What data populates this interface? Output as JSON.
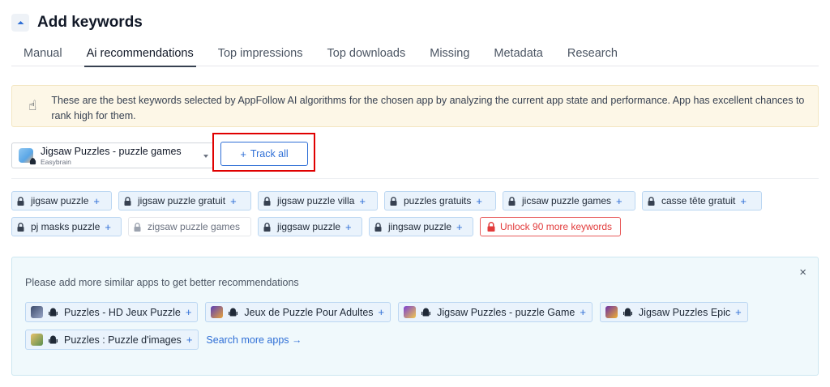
{
  "header": {
    "title": "Add keywords"
  },
  "tabs": [
    {
      "label": "Manual",
      "active": false
    },
    {
      "label": "Ai recommendations",
      "active": true
    },
    {
      "label": "Top impressions",
      "active": false
    },
    {
      "label": "Top downloads",
      "active": false
    },
    {
      "label": "Missing",
      "active": false
    },
    {
      "label": "Metadata",
      "active": false
    },
    {
      "label": "Research",
      "active": false
    }
  ],
  "info": {
    "icon": "pointing-hand-icon",
    "text": "These are the best keywords selected by AppFollow AI algorithms for the chosen app by analyzing the current app state and performance. App has excellent chances to rank high for them."
  },
  "app_select": {
    "name": "Jigsaw Puzzles - puzzle games",
    "developer": "Easybrain"
  },
  "track_all": {
    "label": "Track all"
  },
  "keywords": {
    "row1": [
      {
        "label": "jigsaw puzzle"
      },
      {
        "label": "jigsaw puzzle gratuit"
      },
      {
        "label": "jigsaw puzzle villa"
      },
      {
        "label": "puzzles gratuits"
      },
      {
        "label": "jicsaw puzzle games"
      },
      {
        "label": "casse tête gratuit"
      }
    ],
    "row2": [
      {
        "label": "pj masks puzzle",
        "disabled": false
      },
      {
        "label": "zigsaw puzzle games",
        "disabled": true
      },
      {
        "label": "jiggsaw puzzle",
        "disabled": false
      },
      {
        "label": "jingsaw puzzle",
        "disabled": false
      }
    ],
    "unlock_label": "Unlock 90 more keywords"
  },
  "similar": {
    "text": "Please add more similar apps to get better recommendations",
    "apps_row1": [
      {
        "label": "Puzzles - HD Jeux Puzzle"
      },
      {
        "label": "Jeux de Puzzle Pour Adultes"
      },
      {
        "label": "Jigsaw Puzzles - puzzle Game"
      },
      {
        "label": "Jigsaw Puzzles Epic"
      }
    ],
    "apps_row2": [
      {
        "label": "Puzzles : Puzzle d'images"
      }
    ],
    "search_more": "Search more apps →",
    "close": "×"
  },
  "colors": {
    "accent": "#2f6fd6",
    "danger": "#e23b3b",
    "highlight_border": "#e00000"
  }
}
